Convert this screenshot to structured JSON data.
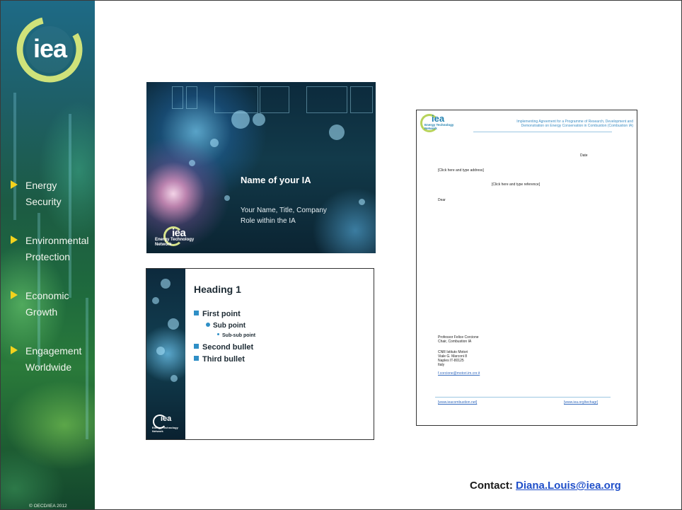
{
  "sidebar": {
    "logo_text": "iea",
    "items": [
      {
        "label": "Energy\nSecurity"
      },
      {
        "label": "Environmental\nProtection"
      },
      {
        "label": "Economic\nGrowth"
      },
      {
        "label": "Engagement\nWorldwide"
      }
    ],
    "copyright": "© OECD/IEA 2012"
  },
  "slide_title_template": {
    "title": "Name of your IA",
    "subtitle": "Your Name, Title, Company\nRole within the IA",
    "logo_text": "iea",
    "logo_sub": "Energy Technology\nNetwork"
  },
  "slide_content_template": {
    "heading": "Heading 1",
    "first_point": "First point",
    "sub_point": "Sub point",
    "sub_sub_point": "Sub-sub point",
    "second_bullet": "Second bullet",
    "third_bullet": "Third bullet",
    "logo_text": "iea",
    "logo_sub": "Energy Technology\nNetwork"
  },
  "letterhead_template": {
    "logo_text": "iea",
    "logo_sub": "Energy Technology\nNetwork",
    "header": "Implementing Agreement for a Programme of Research, Development and\nDemonstration on Energy Conservation in Combustion (Combustion IA)",
    "date": "Date",
    "address": "[Click here and type address]",
    "reference": "[Click here and type reference]",
    "salutation": "Dear",
    "signature": "Professor Felice Corcione\nChair, Combustion IA",
    "institution": "CNR Istituto Motori\nViale G. Marconi 8\nNaples IT-80125\nItaly",
    "email": "f.corcione@motori.im.cnr.it",
    "footer_left": "[www.ieacombustion.net]",
    "footer_right": "[www.iea.org/techagr]"
  },
  "contact": {
    "label": "Contact: ",
    "email": "Diana.Louis@iea.org"
  },
  "colors": {
    "accent_blue": "#2f8fc6",
    "arrow_yellow": "#f2d21d",
    "link_blue": "#1f4fc9"
  }
}
